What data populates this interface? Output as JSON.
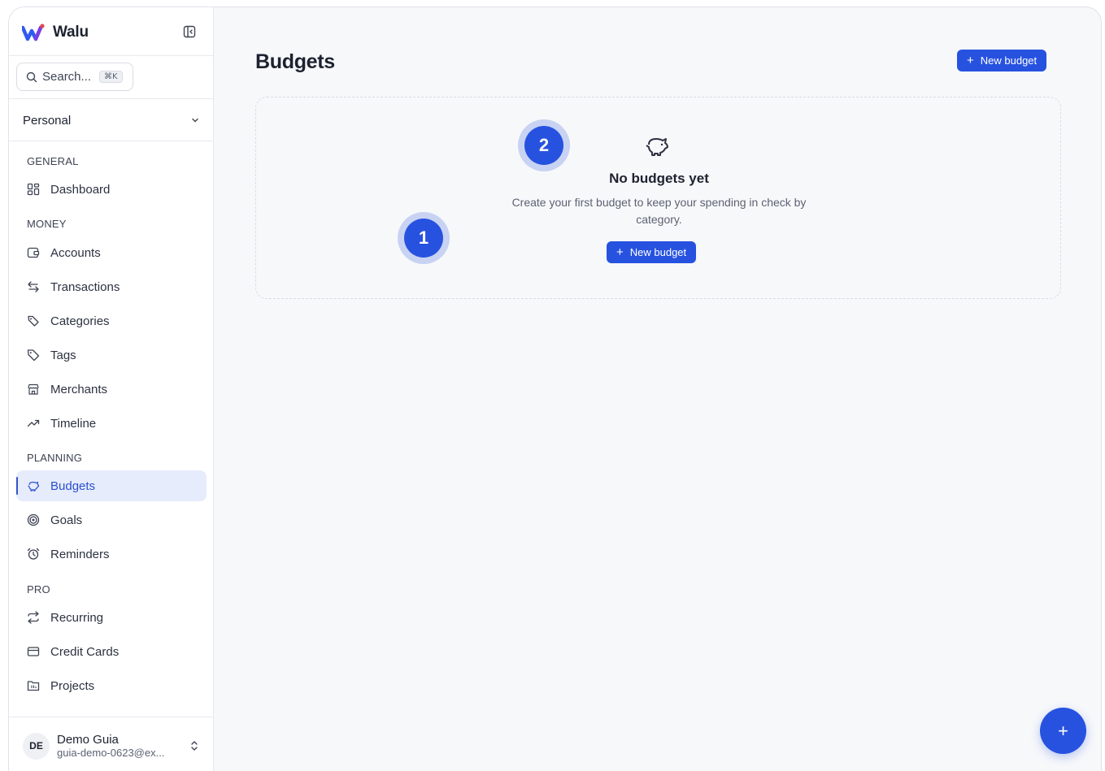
{
  "app": {
    "name": "Walu"
  },
  "search": {
    "placeholder": "Search...",
    "shortcut": "⌘K"
  },
  "workspace": {
    "label": "Personal"
  },
  "sidebar": {
    "sections": [
      {
        "title": "GENERAL",
        "items": [
          {
            "label": "Dashboard",
            "icon": "dashboard-icon"
          }
        ]
      },
      {
        "title": "MONEY",
        "items": [
          {
            "label": "Accounts",
            "icon": "wallet-icon"
          },
          {
            "label": "Transactions",
            "icon": "arrows-exchange-icon"
          },
          {
            "label": "Categories",
            "icon": "tags-icon"
          },
          {
            "label": "Tags",
            "icon": "tag-icon"
          },
          {
            "label": "Merchants",
            "icon": "store-icon"
          },
          {
            "label": "Timeline",
            "icon": "trending-up-icon"
          }
        ]
      },
      {
        "title": "PLANNING",
        "items": [
          {
            "label": "Budgets",
            "icon": "piggy-bank-icon",
            "active": true
          },
          {
            "label": "Goals",
            "icon": "target-icon"
          },
          {
            "label": "Reminders",
            "icon": "alarm-clock-icon"
          }
        ]
      },
      {
        "title": "PRO",
        "items": [
          {
            "label": "Recurring",
            "icon": "repeat-icon"
          },
          {
            "label": "Credit Cards",
            "icon": "credit-card-icon"
          },
          {
            "label": "Projects",
            "icon": "folder-icon"
          }
        ]
      }
    ]
  },
  "user": {
    "initials": "DE",
    "name": "Demo Guia",
    "email": "guia-demo-0623@ex..."
  },
  "main": {
    "title": "Budgets",
    "new_budget_label": "New budget",
    "empty": {
      "title": "No budgets yet",
      "description": "Create your first budget to keep your spending in check by category.",
      "button_label": "New budget"
    }
  },
  "markers": [
    {
      "label": "1"
    },
    {
      "label": "2"
    }
  ],
  "fab": {
    "label": "+"
  },
  "colors": {
    "accent": "#2752e0",
    "active_bg": "#e6ecfb"
  }
}
